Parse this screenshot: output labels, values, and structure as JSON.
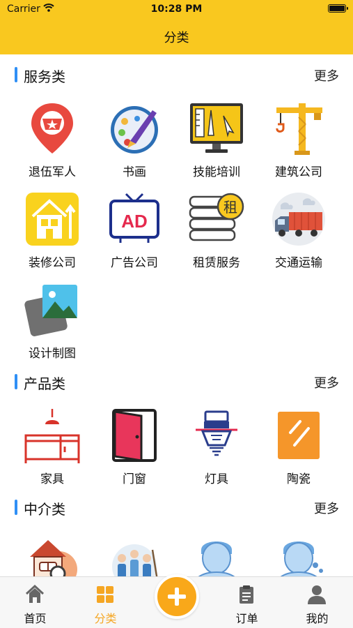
{
  "status_bar": {
    "carrier": "Carrier",
    "time": "10:28 PM"
  },
  "nav": {
    "title": "分类"
  },
  "sections": [
    {
      "title": "服务类",
      "more": "更多",
      "items": [
        {
          "label": "退伍军人",
          "icon": "veteran-pin-icon"
        },
        {
          "label": "书画",
          "icon": "palette-icon"
        },
        {
          "label": "技能培训",
          "icon": "monitor-training-icon"
        },
        {
          "label": "建筑公司",
          "icon": "crane-icon"
        },
        {
          "label": "装修公司",
          "icon": "house-renovation-icon"
        },
        {
          "label": "广告公司",
          "icon": "ad-tv-icon"
        },
        {
          "label": "租赁服务",
          "icon": "rent-stack-icon",
          "badge": "租"
        },
        {
          "label": "交通运输",
          "icon": "truck-icon"
        },
        {
          "label": "设计制图",
          "icon": "picture-frame-icon"
        }
      ]
    },
    {
      "title": "产品类",
      "more": "更多",
      "items": [
        {
          "label": "家具",
          "icon": "furniture-icon"
        },
        {
          "label": "门窗",
          "icon": "door-icon"
        },
        {
          "label": "灯具",
          "icon": "lamp-icon"
        },
        {
          "label": "陶瓷",
          "icon": "ceramic-tile-icon"
        }
      ]
    },
    {
      "title": "中介类",
      "more": "更多",
      "items": [
        {
          "label": "",
          "icon": "house-agent-icon"
        },
        {
          "label": "",
          "icon": "cleaners-icon"
        },
        {
          "label": "",
          "icon": "agent-avatar-icon"
        },
        {
          "label": "",
          "icon": "agent-avatar-2-icon"
        }
      ]
    }
  ],
  "tabbar": {
    "tabs": [
      {
        "label": "首页",
        "icon": "home-icon",
        "active": false
      },
      {
        "label": "分类",
        "icon": "category-grid-icon",
        "active": true
      },
      {
        "label": "订单",
        "icon": "clipboard-icon",
        "active": false
      },
      {
        "label": "我的",
        "icon": "user-icon",
        "active": false
      }
    ],
    "center_icon": "plus-icon"
  },
  "colors": {
    "brand": "#f9c81f",
    "accent": "#f5a623",
    "section_bar": "#2f8ff5"
  }
}
